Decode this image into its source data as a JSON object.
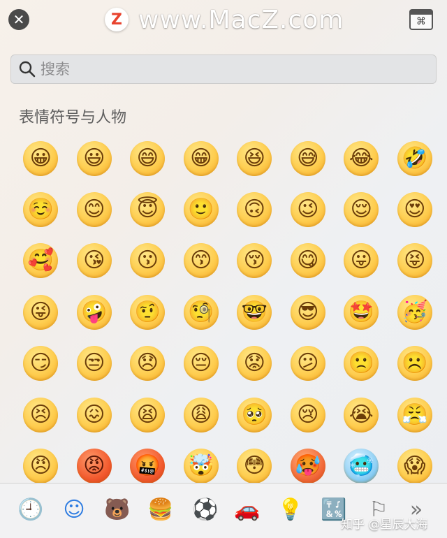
{
  "window": {
    "watermark_logo": "Z",
    "watermark_text": "www.MacZ.com"
  },
  "search": {
    "placeholder": "搜索",
    "value": ""
  },
  "section": {
    "title": "表情符号与人物"
  },
  "emoji_rows": [
    [
      "😀",
      "😃",
      "😄",
      "😁",
      "😆",
      "😅",
      "😂",
      "🤣"
    ],
    [
      "☺️",
      "😊",
      "😇",
      "🙂",
      "🙃",
      "😉",
      "😌",
      "😍"
    ],
    [
      "🥰",
      "😘",
      "😗",
      "😙",
      "😚",
      "😋",
      "😛",
      "😝"
    ],
    [
      "😜",
      "🤪",
      "🤨",
      "🧐",
      "🤓",
      "😎",
      "🤩",
      "🥳"
    ],
    [
      "😏",
      "😒",
      "😞",
      "😔",
      "😟",
      "😕",
      "🙁",
      "☹️"
    ],
    [
      "😣",
      "😖",
      "😫",
      "😩",
      "🥺",
      "😢",
      "😭",
      "😤"
    ],
    [
      "😠",
      "😡",
      "🤬",
      "🤯",
      "😳",
      "🥵",
      "🥶",
      "😱"
    ]
  ],
  "emoji_names": [
    [
      "grinning",
      "smiley",
      "smile",
      "grin",
      "laughing",
      "sweat-smile",
      "joy",
      "rofl"
    ],
    [
      "relaxed",
      "blush",
      "innocent",
      "slight-smile",
      "upside-down",
      "wink",
      "relieved",
      "heart-eyes"
    ],
    [
      "smiling-hearts",
      "kissing-heart",
      "kissing",
      "kissing-smiling-eyes",
      "kissing-closed-eyes",
      "yum",
      "tongue",
      "squinting-tongue"
    ],
    [
      "winking-tongue",
      "zany",
      "raised-eyebrow",
      "monocle",
      "nerd",
      "sunglasses",
      "star-struck",
      "partying"
    ],
    [
      "smirk",
      "unamused",
      "disappointed",
      "pensive",
      "worried",
      "confused",
      "slight-frown",
      "frowning"
    ],
    [
      "persevere",
      "confounded",
      "tired",
      "weary",
      "pleading",
      "cry",
      "sob",
      "triumph"
    ],
    [
      "angry",
      "rage",
      "cursing",
      "exploding-head",
      "flushed",
      "hot",
      "cold",
      "scream"
    ]
  ],
  "face_styles": [
    [
      "",
      "",
      "",
      "",
      "",
      "",
      "",
      ""
    ],
    [
      "",
      "",
      "",
      "",
      "",
      "",
      "",
      ""
    ],
    [
      "",
      "",
      "",
      "",
      "",
      "",
      "",
      ""
    ],
    [
      "",
      "",
      "",
      "",
      "",
      "",
      "",
      ""
    ],
    [
      "",
      "",
      "",
      "",
      "",
      "",
      "",
      ""
    ],
    [
      "",
      "",
      "",
      "",
      "",
      "",
      "",
      ""
    ],
    [
      "",
      "red",
      "red",
      "",
      "",
      "hot",
      "blue",
      ""
    ]
  ],
  "category_icons": [
    {
      "name": "recent-clock-icon",
      "glyph": "🕘"
    },
    {
      "name": "smileys-people-icon",
      "glyph": "☺"
    },
    {
      "name": "animals-nature-icon",
      "glyph": "🐻"
    },
    {
      "name": "food-drink-icon",
      "glyph": "🍔"
    },
    {
      "name": "activity-ball-icon",
      "glyph": "⚽"
    },
    {
      "name": "travel-places-icon",
      "glyph": "🚗"
    },
    {
      "name": "objects-bulb-icon",
      "glyph": "💡"
    },
    {
      "name": "symbols-icon",
      "glyph": "🔣"
    },
    {
      "name": "flags-icon",
      "glyph": "⚐"
    },
    {
      "name": "more-chevron-icon",
      "glyph": "»"
    }
  ],
  "active_category": "smileys-people-icon",
  "footer_watermark": "知乎 @星辰大海",
  "colors": {
    "accent": "#2f7de1",
    "search_bg": "#e3e4e6"
  }
}
